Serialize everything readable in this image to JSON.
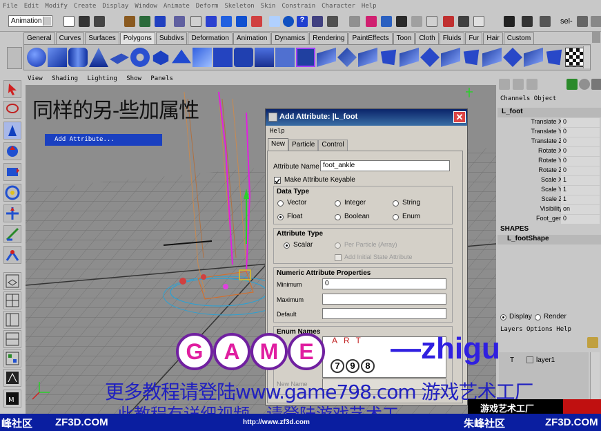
{
  "menubar": [
    "File",
    "Edit",
    "Modify",
    "Create",
    "Display",
    "Window",
    "Animate",
    "Deform",
    "Skeleton",
    "Skin",
    "Constrain",
    "Character",
    "Help"
  ],
  "status": {
    "mode": "Animation",
    "sel_label": "sel-"
  },
  "shelf_tabs": [
    "General",
    "Curves",
    "Surfaces",
    "Polygons",
    "Subdivs",
    "Deformation",
    "Animation",
    "Dynamics",
    "Rendering",
    "PaintEffects",
    "Toon",
    "Cloth",
    "Fluids",
    "Fur",
    "Hair",
    "Custom"
  ],
  "shelf_active": "Polygons",
  "viewport": {
    "menu": [
      "View",
      "Shading",
      "Lighting",
      "Show",
      "Panels"
    ],
    "handwriting": "同样的另-些加属性",
    "popup_item": "Add Attribute..."
  },
  "channelbox": {
    "menu": [
      "Channels",
      "Object"
    ],
    "node": "L_foot",
    "attrs": [
      {
        "name": "Translate X",
        "value": "0"
      },
      {
        "name": "Translate Y",
        "value": "0"
      },
      {
        "name": "Translate Z",
        "value": "0"
      },
      {
        "name": "Rotate X",
        "value": "0"
      },
      {
        "name": "Rotate Y",
        "value": "0"
      },
      {
        "name": "Rotate Z",
        "value": "0"
      },
      {
        "name": "Scale X",
        "value": "1"
      },
      {
        "name": "Scale Y",
        "value": "1"
      },
      {
        "name": "Scale Z",
        "value": "1"
      },
      {
        "name": "Visibility",
        "value": "on"
      },
      {
        "name": "Foot_gen",
        "value": "0"
      }
    ],
    "shapes_header": "SHAPES",
    "shape": "L_footShape",
    "display": "Display",
    "render": "Render",
    "layers_menu": [
      "Layers",
      "Options",
      "Help"
    ],
    "layer": "layer1",
    "layer_flag": "T"
  },
  "dialog": {
    "title": "Add Attribute:  |L_foot",
    "menu": "Help",
    "tabs": [
      "New",
      "Particle",
      "Control"
    ],
    "attr_name_label": "Attribute Name",
    "attr_name_value": "foot_ankle",
    "keyable_label": "Make Attribute Keyable",
    "data_type": {
      "title": "Data Type",
      "options": [
        "Vector",
        "Integer",
        "String",
        "Float",
        "Boolean",
        "Enum"
      ],
      "selected": "Float"
    },
    "attr_type": {
      "title": "Attribute Type",
      "scalar": "Scalar",
      "per_particle": "Per Particle (Array)",
      "initial_state": "Add Initial State Attribute"
    },
    "numeric": {
      "title": "Numeric Attribute Properties",
      "minimum": "Minimum",
      "minimum_value": "0",
      "maximum": "Maximum",
      "default": "Default"
    },
    "enum": {
      "title": "Enum Names",
      "new_name": "New Name"
    }
  },
  "watermark": {
    "zhigu": "—zhigu",
    "game_letters": [
      "G",
      "A",
      "M",
      "E"
    ],
    "art": "ART",
    "art_digits": [
      "7",
      "9",
      "8"
    ],
    "line1": "更多教程请登陆www.game798.com 游戏艺术工厂",
    "line2": "此教程有详细视频，请登陆游戏艺术工",
    "badge": "游戏艺术工厂"
  },
  "bottom": {
    "left": "峰社区",
    "zf3d1": "ZF3D.COM",
    "url": "http://www.zf3d.com",
    "right": "朱峰社区",
    "zf3d2": "ZF3D.COM"
  },
  "colors": {
    "title_bar": "#0a246a",
    "magenta": "#e020e0",
    "orange": "#d86020"
  }
}
